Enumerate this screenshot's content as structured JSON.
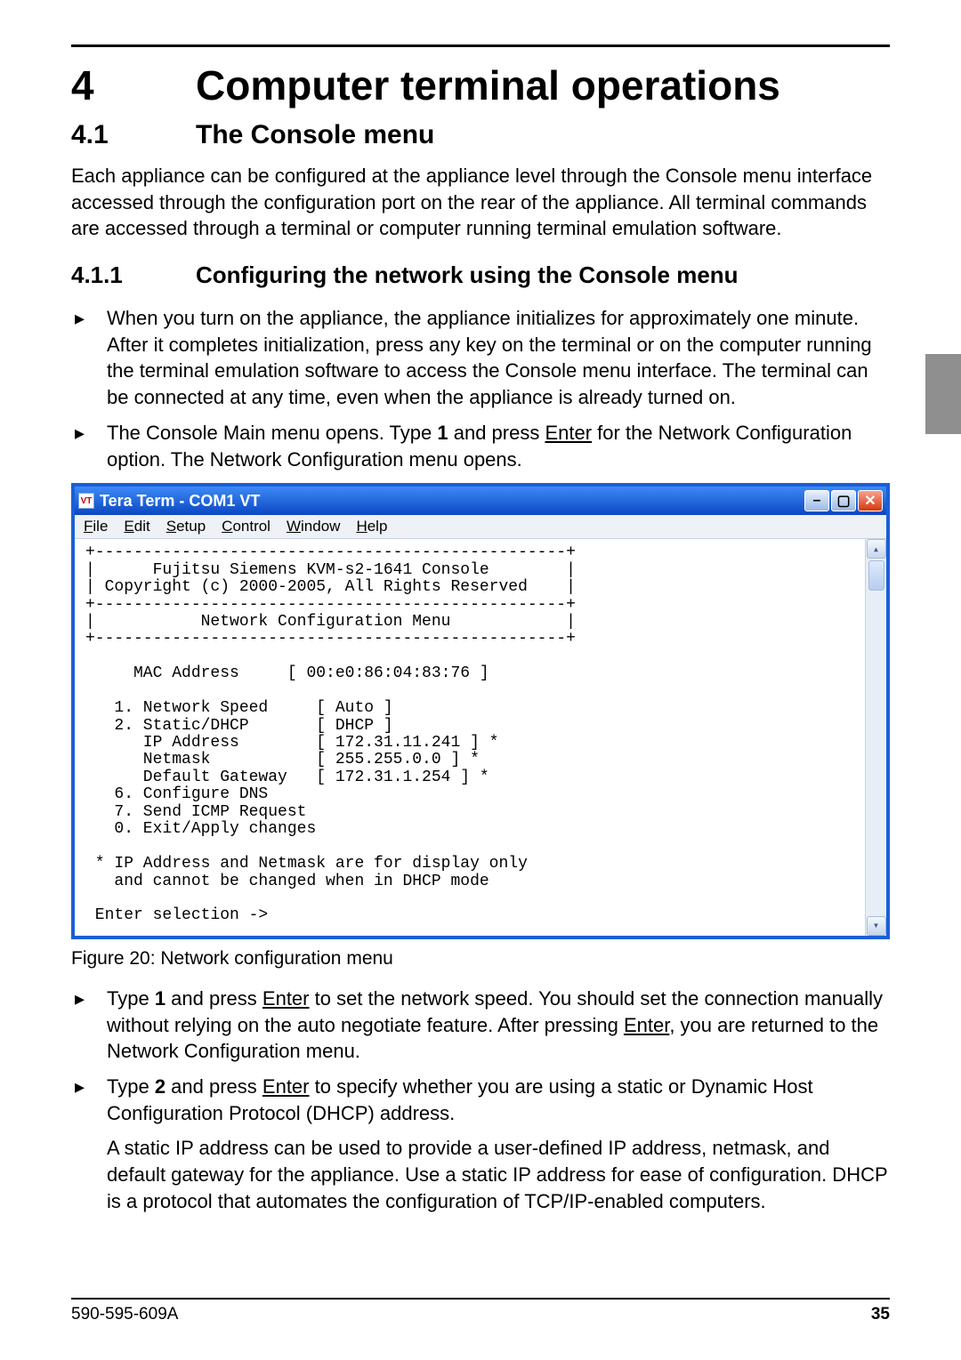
{
  "chapter": {
    "number": "4",
    "title": "Computer terminal operations"
  },
  "section": {
    "number": "4.1",
    "title": "The Console menu"
  },
  "intro_para": "Each appliance can be configured at the appliance level through the Console menu interface accessed through the configuration port on the rear of the appliance. All terminal commands are accessed through a terminal or computer running terminal emulation software.",
  "subsection": {
    "number": "4.1.1",
    "title": "Configuring the network using the Console menu"
  },
  "bullets_1": [
    "When you turn on the appliance, the appliance initializes for approximately one minute. After it completes initialization, press any key on the terminal or on the computer running the terminal emulation software to access the Console menu interface. The terminal can be connected at any time, even when the appliance is already turned on.",
    "The Console Main menu opens. Type 1 and press Enter for the Network Configuration option. The Network Configuration menu opens."
  ],
  "terminal": {
    "title": "Tera Term - COM1 VT",
    "icon_text": "VT",
    "menu": [
      "File",
      "Edit",
      "Setup",
      "Control",
      "Window",
      "Help"
    ],
    "header_line1": "Fujitsu Siemens KVM-s2-1641 Console",
    "header_line2": "Copyright (c) 2000-2005, All Rights Reserved",
    "subtitle": "Network Configuration Menu",
    "mac_label": "MAC Address",
    "mac_value": "00:e0:86:04:83:76",
    "options": [
      {
        "num": "1.",
        "label": "Network Speed",
        "value": "Auto",
        "star": false
      },
      {
        "num": "2.",
        "label": "Static/DHCP",
        "value": "DHCP",
        "star": false
      },
      {
        "num": "",
        "label": "IP Address",
        "value": "172.31.11.241",
        "star": true
      },
      {
        "num": "",
        "label": "Netmask",
        "value": "255.255.0.0",
        "star": true
      },
      {
        "num": "",
        "label": "Default Gateway",
        "value": "172.31.1.254",
        "star": true
      },
      {
        "num": "6.",
        "label": "Configure DNS",
        "value": "",
        "star": false
      },
      {
        "num": "7.",
        "label": "Send ICMP Request",
        "value": "",
        "star": false
      },
      {
        "num": "0.",
        "label": "Exit/Apply changes",
        "value": "",
        "star": false
      }
    ],
    "note_line1": "* IP Address and Netmask are for display only",
    "note_line2": "and cannot be changed when in DHCP mode",
    "prompt": "Enter selection ->"
  },
  "figure_caption": "Figure 20: Network configuration menu",
  "bullets_2": [
    {
      "pre": "Type ",
      "key1": "1",
      "mid1": " and press ",
      "enter1": "Enter",
      "mid2": " to set the network speed. You should set the connection manually without relying on the auto negotiate feature. After pressing ",
      "enter2": "Enter",
      "post": ", you are returned to the Network Configuration menu."
    },
    {
      "pre": "Type ",
      "key1": "2",
      "mid1": " and press ",
      "enter1": "Enter",
      "mid2": " to specify whether you are using a static or Dynamic Host Configuration Protocol (DHCP) address.",
      "enter2": "",
      "post": ""
    }
  ],
  "tail_para": "A static IP address can be used to provide a user-defined IP address, netmask, and default gateway for the appliance. Use a static IP address for ease of configuration. DHCP is a protocol that automates the configuration of TCP/IP-enabled computers.",
  "footer": {
    "doc_id": "590-595-609A",
    "page": "35"
  }
}
